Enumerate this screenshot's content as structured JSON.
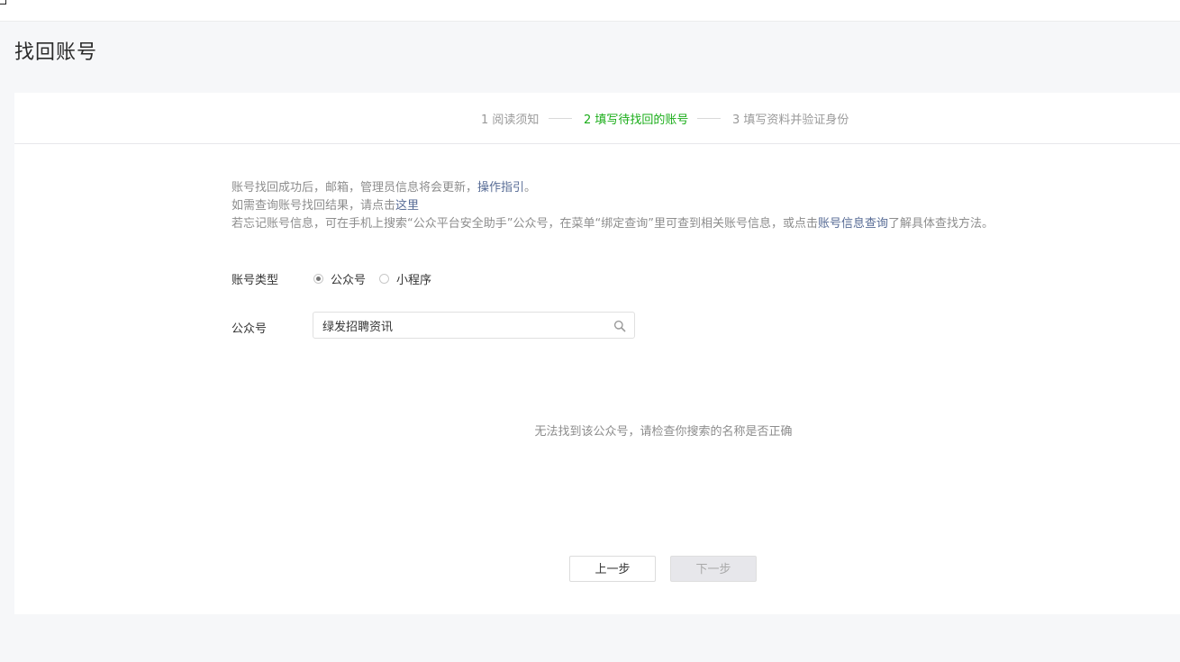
{
  "page": {
    "title": "找回账号"
  },
  "steps": [
    {
      "label": "1 阅读须知"
    },
    {
      "label": "2 填写待找回的账号"
    },
    {
      "label": "3 填写资料并验证身份"
    }
  ],
  "notice": {
    "line1_text": "账号找回成功后，邮箱，管理员信息将会更新，",
    "line1_link": "操作指引",
    "line1_end": "。",
    "line2_text": "如需查询账号找回结果，请点击",
    "line2_link": "这里",
    "line3_text": "若忘记账号信息，可在手机上搜索“公众平台安全助手”公众号，在菜单“绑定查询”里可查到相关账号信息，或点击",
    "line3_link": "账号信息查询",
    "line3_end": "了解具体查找方法。"
  },
  "form": {
    "account_type_label": "账号类型",
    "account_type_options": [
      {
        "label": "公众号",
        "checked": true
      },
      {
        "label": "小程序",
        "checked": false
      }
    ],
    "account_label": "公众号",
    "search_value": "绿发招聘资讯"
  },
  "empty_message": "无法找到该公众号，请检查你搜索的名称是否正确",
  "buttons": {
    "prev_label": "上一步",
    "next_label": "下一步",
    "next_disabled": true
  },
  "colors": {
    "active_step": "#1aad19",
    "link": "#576b95",
    "muted_text": "#8d8d8d",
    "background": "#f6f7f9"
  },
  "icons": {
    "search": "search-icon"
  }
}
